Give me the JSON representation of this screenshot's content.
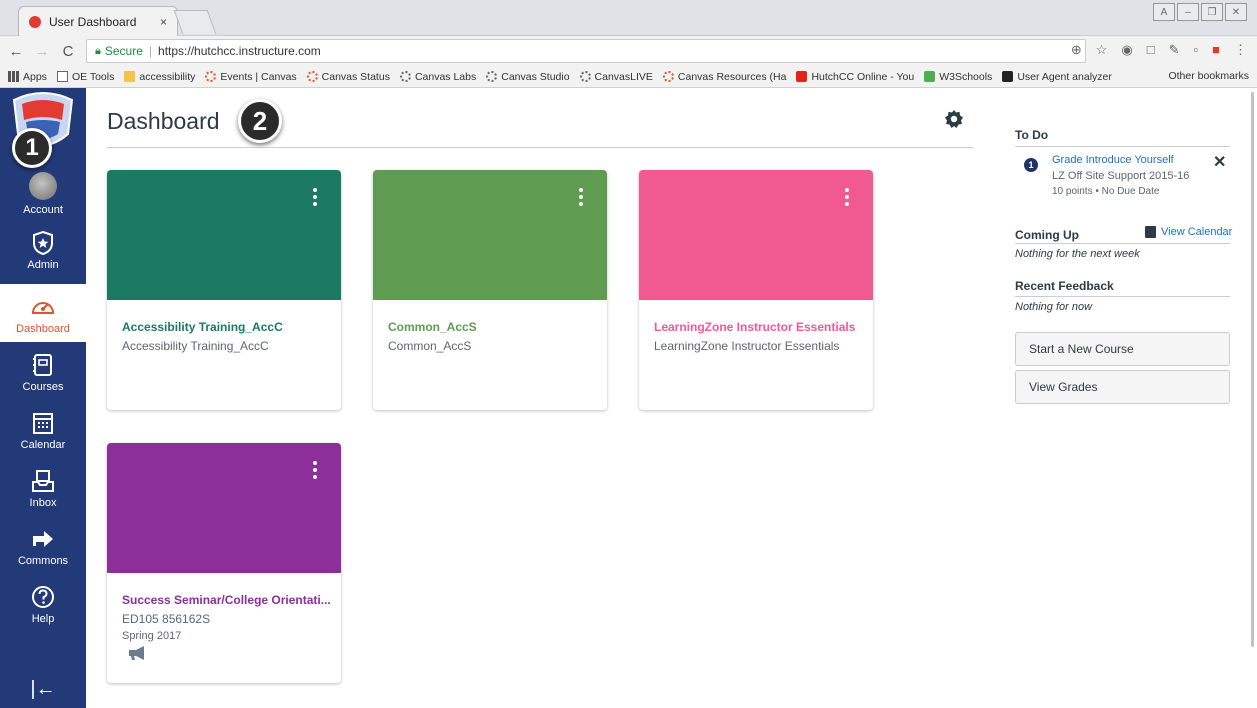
{
  "browser": {
    "tab_title": "User Dashboard",
    "tab_close": "×",
    "secure_label": "Secure",
    "url": "https://hutchcc.instructure.com",
    "bookmarks": [
      {
        "label": "Apps",
        "icon": "apps-icon"
      },
      {
        "label": "OE Tools",
        "icon": "page-icon"
      },
      {
        "label": "accessibility",
        "icon": "folder-icon"
      },
      {
        "label": "Events | Canvas",
        "icon": "canvas-icon"
      },
      {
        "label": "Canvas Status",
        "icon": "canvas-icon"
      },
      {
        "label": "Canvas Labs",
        "icon": "canvas-gray-icon"
      },
      {
        "label": "Canvas Studio",
        "icon": "canvas-gray-icon"
      },
      {
        "label": "CanvasLIVE",
        "icon": "canvas-gray-icon"
      },
      {
        "label": "Canvas Resources (Ha",
        "icon": "canvas-icon"
      },
      {
        "label": "HutchCC Online - You",
        "icon": "youtube-icon"
      },
      {
        "label": "W3Schools",
        "icon": "w3schools-icon"
      },
      {
        "label": "User Agent analyzer",
        "icon": "u-icon"
      }
    ],
    "other_bookmarks": "Other bookmarks"
  },
  "nav": {
    "account": "Account",
    "admin": "Admin",
    "dashboard": "Dashboard",
    "courses": "Courses",
    "calendar": "Calendar",
    "inbox": "Inbox",
    "commons": "Commons",
    "help": "Help",
    "collapse": "|←"
  },
  "annotations": {
    "one": "1",
    "two": "2"
  },
  "page": {
    "title": "Dashboard"
  },
  "cards": [
    {
      "title": "Accessibility Training_AccC",
      "subtitle": "Accessibility Training_AccC",
      "term": "",
      "color": "#1c7a62"
    },
    {
      "title": "Common_AccS",
      "subtitle": "Common_AccS",
      "term": "",
      "color": "#5f9b50"
    },
    {
      "title": "LearningZone Instructor Essentials",
      "subtitle": "LearningZone Instructor Essentials",
      "term": "",
      "color": "#f05a91"
    },
    {
      "title": "Success Seminar/College Orientati...",
      "subtitle": "ED105 856162S",
      "term": "Spring 2017",
      "color": "#8d2f9b"
    }
  ],
  "sidebar": {
    "todo_heading": "To Do",
    "todo_count": "1",
    "todo_item_title": "Grade Introduce Yourself",
    "todo_item_course": "LZ Off Site Support 2015-16",
    "todo_item_meta": "10 points • No Due Date",
    "todo_dismiss": "✕",
    "coming_up_heading": "Coming Up",
    "view_calendar": "View Calendar",
    "coming_up_empty": "Nothing for the next week",
    "feedback_heading": "Recent Feedback",
    "feedback_empty": "Nothing for now",
    "start_course": "Start a New Course",
    "view_grades": "View Grades"
  }
}
